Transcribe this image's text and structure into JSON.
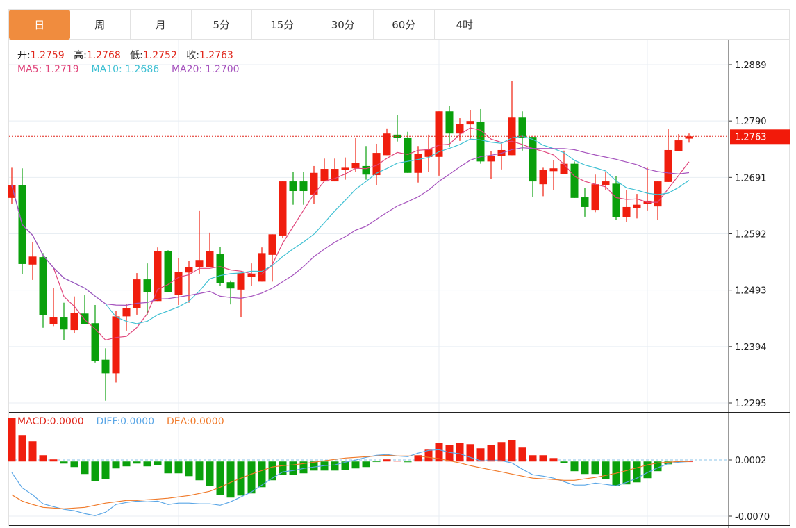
{
  "tabs": [
    {
      "label": "日",
      "active": true
    },
    {
      "label": "周"
    },
    {
      "label": "月"
    },
    {
      "label": "5分"
    },
    {
      "label": "15分"
    },
    {
      "label": "30分"
    },
    {
      "label": "60分"
    },
    {
      "label": "4时"
    }
  ],
  "ohlc_legend": {
    "open_label": "开:",
    "open": "1.2759",
    "high_label": "高:",
    "high": "1.2768",
    "low_label": "低:",
    "low": "1.2752",
    "close_label": "收:",
    "close": "1.2763"
  },
  "ma_legend": {
    "ma5": "MA5: 1.2719",
    "ma10": "MA10: 1.2686",
    "ma20": "MA20: 1.2700"
  },
  "macd_legend": {
    "macd": "MACD:0.0000",
    "diff": "DIFF:0.0000",
    "dea": "DEA:0.0000"
  },
  "colors": {
    "up": "#f01e0e",
    "down": "#0aa00c",
    "ma5": "#e0457b",
    "ma10": "#3fc0d3",
    "ma20": "#a552bd",
    "diff": "#5aa6e6",
    "dea": "#f07a2a",
    "accent": "#f08c3e"
  },
  "chart_data": [
    {
      "type": "candlestick",
      "title": "",
      "ylim": [
        1.2295,
        1.2889
      ],
      "yticks": [
        "1.2889",
        "1.2790",
        "1.2691",
        "1.2592",
        "1.2493",
        "1.2394",
        "1.2295"
      ],
      "current_price": "1.2763",
      "ma_periods": [
        5,
        10,
        20
      ],
      "ohlc": [
        [
          1.2655,
          1.2708,
          1.2645,
          1.2677
        ],
        [
          1.2677,
          1.2707,
          1.2521,
          1.2539
        ],
        [
          1.2538,
          1.2578,
          1.2511,
          1.2552
        ],
        [
          1.2551,
          1.2558,
          1.2427,
          1.2449
        ],
        [
          1.2434,
          1.2497,
          1.243,
          1.2445
        ],
        [
          1.2445,
          1.2471,
          1.2406,
          1.2424
        ],
        [
          1.2423,
          1.2482,
          1.2417,
          1.2453
        ],
        [
          1.2452,
          1.2484,
          1.2434,
          1.2434
        ],
        [
          1.2435,
          1.2467,
          1.2366,
          1.2369
        ],
        [
          1.2371,
          1.2391,
          1.2299,
          1.2347
        ],
        [
          1.2347,
          1.2457,
          1.2331,
          1.2447
        ],
        [
          1.2447,
          1.2469,
          1.2422,
          1.2462
        ],
        [
          1.2462,
          1.2523,
          1.245,
          1.2512
        ],
        [
          1.2512,
          1.254,
          1.245,
          1.249
        ],
        [
          1.2474,
          1.2568,
          1.2474,
          1.2561
        ],
        [
          1.2561,
          1.2563,
          1.249,
          1.249
        ],
        [
          1.2485,
          1.2549,
          1.2467,
          1.2525
        ],
        [
          1.2524,
          1.2544,
          1.2471,
          1.2534
        ],
        [
          1.2533,
          1.2633,
          1.2522,
          1.2546
        ],
        [
          1.2533,
          1.2594,
          1.2533,
          1.2561
        ],
        [
          1.2556,
          1.2569,
          1.25,
          1.2506
        ],
        [
          1.2507,
          1.251,
          1.2468,
          1.2496
        ],
        [
          1.2494,
          1.2523,
          1.2445,
          1.2523
        ],
        [
          1.2516,
          1.254,
          1.2501,
          1.2522
        ],
        [
          1.2508,
          1.2568,
          1.2508,
          1.2558
        ],
        [
          1.2555,
          1.2591,
          1.2508,
          1.2591
        ],
        [
          1.2589,
          1.2684,
          1.2584,
          1.2684
        ],
        [
          1.2684,
          1.2701,
          1.2643,
          1.2667
        ],
        [
          1.2684,
          1.2701,
          1.2643,
          1.2667
        ],
        [
          1.2661,
          1.2711,
          1.2645,
          1.2699
        ],
        [
          1.2684,
          1.2724,
          1.2684,
          1.2706
        ],
        [
          1.2684,
          1.2724,
          1.2684,
          1.2706
        ],
        [
          1.2704,
          1.2726,
          1.2687,
          1.2708
        ],
        [
          1.2707,
          1.2761,
          1.27,
          1.2716
        ],
        [
          1.2711,
          1.2746,
          1.2687,
          1.2696
        ],
        [
          1.2695,
          1.275,
          1.2677,
          1.2734
        ],
        [
          1.273,
          1.2777,
          1.273,
          1.2768
        ],
        [
          1.2766,
          1.28,
          1.2754,
          1.276
        ],
        [
          1.2761,
          1.2771,
          1.2699,
          1.2699
        ],
        [
          1.2699,
          1.2746,
          1.2682,
          1.2732
        ],
        [
          1.2727,
          1.2766,
          1.2701,
          1.274
        ],
        [
          1.2727,
          1.2807,
          1.2694,
          1.2807
        ],
        [
          1.2807,
          1.2817,
          1.2744,
          1.2768
        ],
        [
          1.2768,
          1.2795,
          1.2755,
          1.2785
        ],
        [
          1.2784,
          1.2809,
          1.2759,
          1.279
        ],
        [
          1.2788,
          1.2811,
          1.2715,
          1.2719
        ],
        [
          1.2719,
          1.2737,
          1.2688,
          1.2729
        ],
        [
          1.2728,
          1.275,
          1.2705,
          1.2739
        ],
        [
          1.273,
          1.286,
          1.273,
          1.2796
        ],
        [
          1.2796,
          1.2807,
          1.2738,
          1.2761
        ],
        [
          1.2762,
          1.2762,
          1.2657,
          1.2684
        ],
        [
          1.2679,
          1.2708,
          1.2658,
          1.2704
        ],
        [
          1.2702,
          1.2721,
          1.2669,
          1.2707
        ],
        [
          1.2697,
          1.2738,
          1.2697,
          1.2715
        ],
        [
          1.2715,
          1.2719,
          1.2655,
          1.2655
        ],
        [
          1.2656,
          1.2672,
          1.2622,
          1.2639
        ],
        [
          1.2634,
          1.2696,
          1.263,
          1.2679
        ],
        [
          1.2678,
          1.2701,
          1.2669,
          1.2684
        ],
        [
          1.268,
          1.2693,
          1.2616,
          1.2621
        ],
        [
          1.2621,
          1.2669,
          1.2613,
          1.2639
        ],
        [
          1.2637,
          1.2662,
          1.2619,
          1.2643
        ],
        [
          1.2645,
          1.2708,
          1.2633,
          1.265
        ],
        [
          1.264,
          1.2685,
          1.2616,
          1.2684
        ],
        [
          1.2683,
          1.2776,
          1.2683,
          1.2739
        ],
        [
          1.2737,
          1.2767,
          1.2737,
          1.2756
        ],
        [
          1.2759,
          1.2768,
          1.2752,
          1.2763
        ]
      ]
    },
    {
      "type": "bar+line",
      "title": "MACD",
      "ylim": [
        -0.007,
        0.0002
      ],
      "yticks": [
        "0.0002",
        "-0.0070"
      ],
      "macd": [
        0.0056,
        0.00338,
        0.00258,
        0.0008,
        0.00027,
        -0.00027,
        -0.00071,
        -0.0016,
        -0.00249,
        -0.00222,
        -0.00089,
        -0.00062,
        -0.00027,
        -0.00062,
        -0.00044,
        -0.00151,
        -0.00151,
        -0.00187,
        -0.0024,
        -0.00311,
        -0.00427,
        -0.00462,
        -0.00436,
        -0.00409,
        -0.00329,
        -0.0024,
        -0.00169,
        -0.00169,
        -0.00151,
        -0.00116,
        -0.00116,
        -0.00116,
        -0.00107,
        -0.00089,
        -0.00071,
        -3e-05,
        0.00027,
        9e-05,
        -9e-05,
        0.0008,
        0.00151,
        0.0024,
        0.00213,
        0.0024,
        0.00222,
        0.00169,
        0.00213,
        0.00249,
        0.00276,
        0.00178,
        0.0008,
        0.0008,
        0.00044,
        -0.00018,
        -0.00124,
        -0.0016,
        -0.0016,
        -0.00222,
        -0.00311,
        -0.00293,
        -0.00267,
        -0.00213,
        -0.00124,
        -0.00036,
        -4e-05,
        0
      ],
      "diff": [
        -0.00142,
        -0.00338,
        -0.00427,
        -0.00542,
        -0.00578,
        -0.00613,
        -0.00631,
        -0.00667,
        -0.00693,
        -0.00649,
        -0.00551,
        -0.00525,
        -0.00507,
        -0.00516,
        -0.00507,
        -0.00551,
        -0.00533,
        -0.00533,
        -0.00542,
        -0.00542,
        -0.0056,
        -0.00516,
        -0.00453,
        -0.00391,
        -0.00302,
        -0.00213,
        -0.00133,
        -0.00116,
        -0.00089,
        -0.00071,
        -0.00053,
        -0.00044,
        -9e-05,
        0.00018,
        0.00053,
        0.0008,
        0.00089,
        0.00071,
        0.00062,
        0.00107,
        0.00142,
        0.00151,
        0.00116,
        0.00098,
        0.00053,
        9e-05,
        9e-05,
        9e-05,
        -0.00018,
        -0.00098,
        -0.00169,
        -0.00187,
        -0.00213,
        -0.00258,
        -0.00302,
        -0.00302,
        -0.00276,
        -0.00293,
        -0.00311,
        -0.00267,
        -0.00213,
        -0.00142,
        -0.0008,
        -0.00027,
        -9e-05,
        0
      ],
      "dea": [
        -0.00427,
        -0.00507,
        -0.00551,
        -0.00587,
        -0.00596,
        -0.00605,
        -0.00596,
        -0.00587,
        -0.0056,
        -0.00533,
        -0.00516,
        -0.00498,
        -0.00498,
        -0.00489,
        -0.0048,
        -0.00471,
        -0.00453,
        -0.00436,
        -0.00409,
        -0.00382,
        -0.00329,
        -0.00267,
        -0.00213,
        -0.0016,
        -0.00116,
        -0.00071,
        -0.00053,
        -0.00044,
        -0.00027,
        -9e-05,
        9e-05,
        0.00027,
        0.00044,
        0.00053,
        0.00062,
        0.00071,
        0.0008,
        0.00071,
        0.00071,
        0.00071,
        0.00053,
        0.00036,
        9e-05,
        -0.00018,
        -0.00053,
        -0.0008,
        -0.00107,
        -0.00133,
        -0.0016,
        -0.00187,
        -0.00213,
        -0.00222,
        -0.00231,
        -0.0024,
        -0.0024,
        -0.00222,
        -0.00204,
        -0.00178,
        -0.00151,
        -0.00116,
        -0.0008,
        -0.00044,
        -0.00018,
        -9e-05,
        0,
        0
      ]
    }
  ]
}
